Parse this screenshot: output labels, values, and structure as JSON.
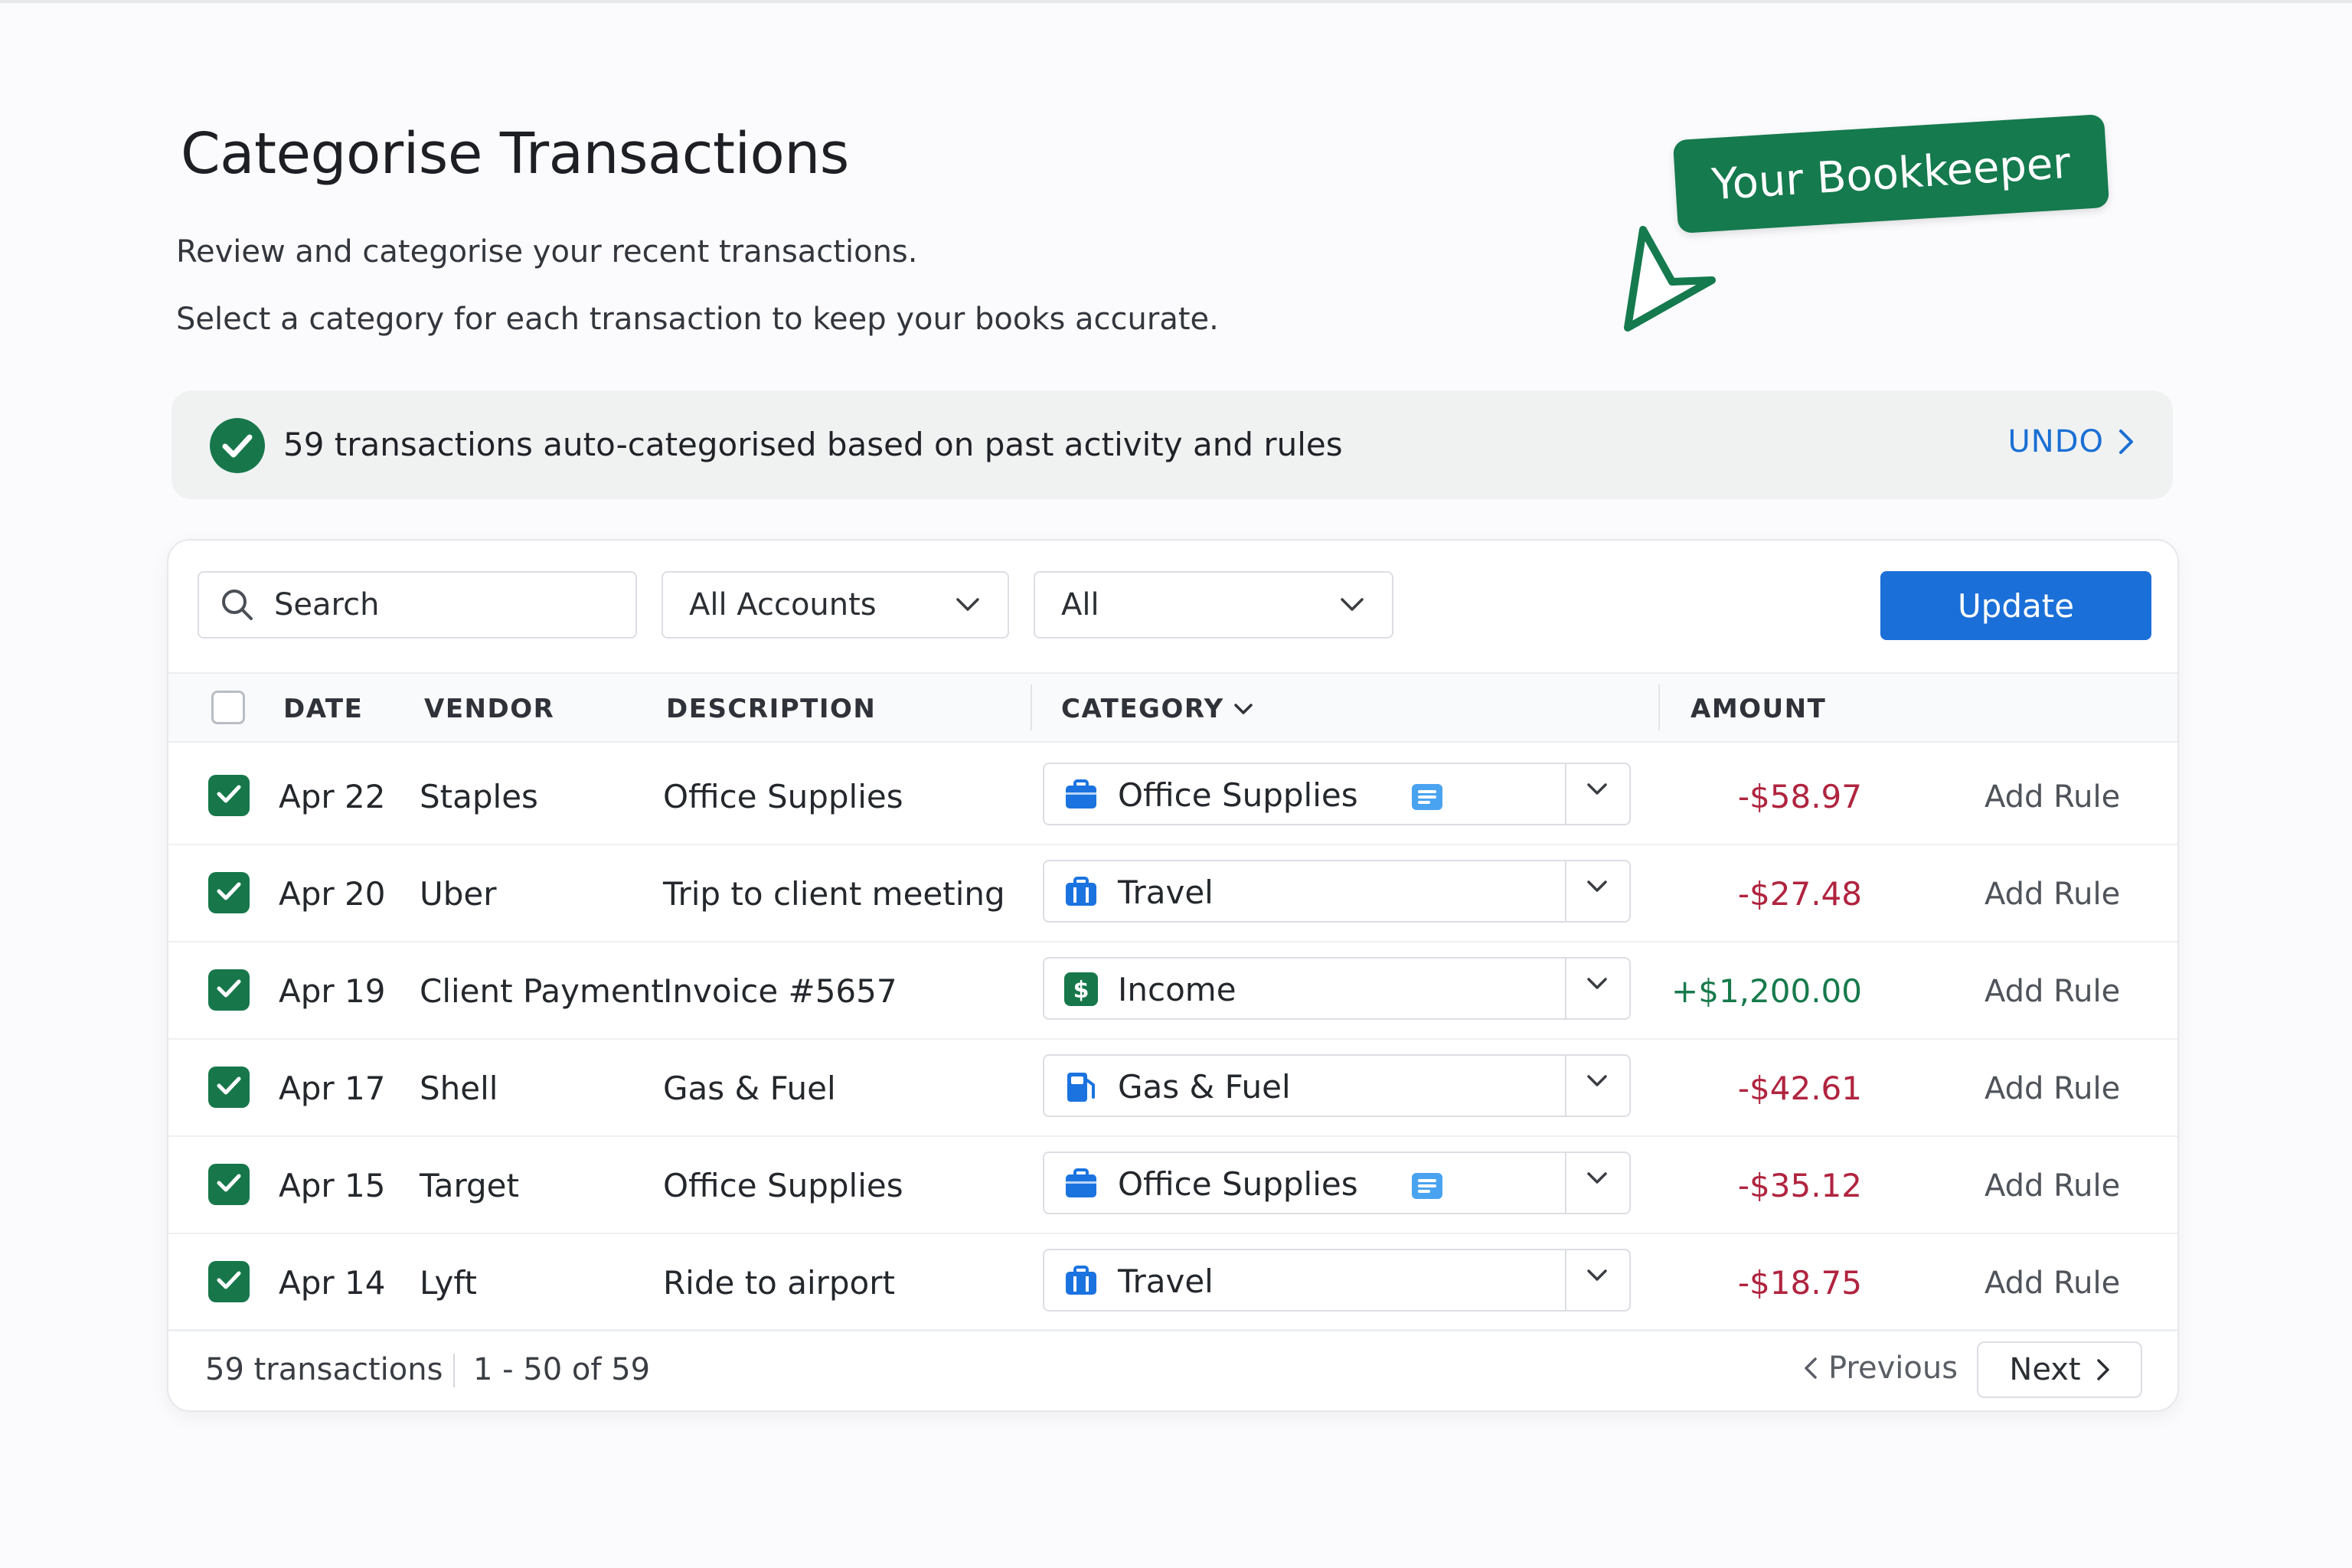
{
  "page": {
    "title": "Categorise Transactions",
    "subtitle_1": "Review and categorise your recent transactions.",
    "subtitle_2": "Select a category for each transaction to keep your books accurate.",
    "tag": "Your Bookkeeper"
  },
  "banner": {
    "message": "59 transactions auto-categorised based on past activity and rules",
    "undo_label": "UNDO"
  },
  "toolbar": {
    "search_placeholder": "Search",
    "accounts_value": "All Accounts",
    "filter_value": "All",
    "update_label": "Update"
  },
  "table": {
    "headers": {
      "date": "DATE",
      "vendor": "VENDOR",
      "description": "DESCRIPTION",
      "category": "CATEGORY",
      "amount": "AMOUNT"
    },
    "rows": [
      {
        "date": "Apr 22",
        "vendor": "Staples",
        "description": "Office Supplies",
        "category": "Office Supplies",
        "category_icon": "briefcase-icon",
        "has_note": true,
        "amount": "-$58.97",
        "amount_color": "#b0243f",
        "action": "Add Rule"
      },
      {
        "date": "Apr 20",
        "vendor": "Uber",
        "description": "Trip to client meeting",
        "category": "Travel",
        "category_icon": "travel-bag-icon",
        "has_note": false,
        "amount": "-$27.48",
        "amount_color": "#b0243f",
        "action": "Add Rule"
      },
      {
        "date": "Apr 19",
        "vendor": "Client Payment",
        "description": "Invoice #5657",
        "category": "Income",
        "category_icon": "dollar-icon",
        "has_note": false,
        "amount": "+$1,200.00",
        "amount_color": "#177a4c",
        "action": "Add Rule"
      },
      {
        "date": "Apr 17",
        "vendor": "Shell",
        "description": "Gas & Fuel",
        "category": "Gas & Fuel",
        "category_icon": "fuel-pump-icon",
        "has_note": false,
        "amount": "-$42.61",
        "amount_color": "#b0243f",
        "action": "Add Rule"
      },
      {
        "date": "Apr 15",
        "vendor": "Target",
        "description": "Office Supplies",
        "category": "Office Supplies",
        "category_icon": "briefcase-icon",
        "has_note": true,
        "amount": "-$35.12",
        "amount_color": "#b0243f",
        "action": "Add Rule"
      },
      {
        "date": "Apr 14",
        "vendor": "Lyft",
        "description": "Ride to airport",
        "category": "Travel",
        "category_icon": "travel-bag-icon",
        "has_note": false,
        "amount": "-$18.75",
        "amount_color": "#b0243f",
        "action": "Add Rule"
      }
    ]
  },
  "footer": {
    "count": "59 transactions",
    "range": "1 - 50 of 59",
    "previous_label": "Previous",
    "next_label": "Next"
  },
  "colors": {
    "brand_green": "#157a4e",
    "primary_blue": "#1b6fd8",
    "negative_red": "#b0243f",
    "positive_green": "#177a4c"
  }
}
